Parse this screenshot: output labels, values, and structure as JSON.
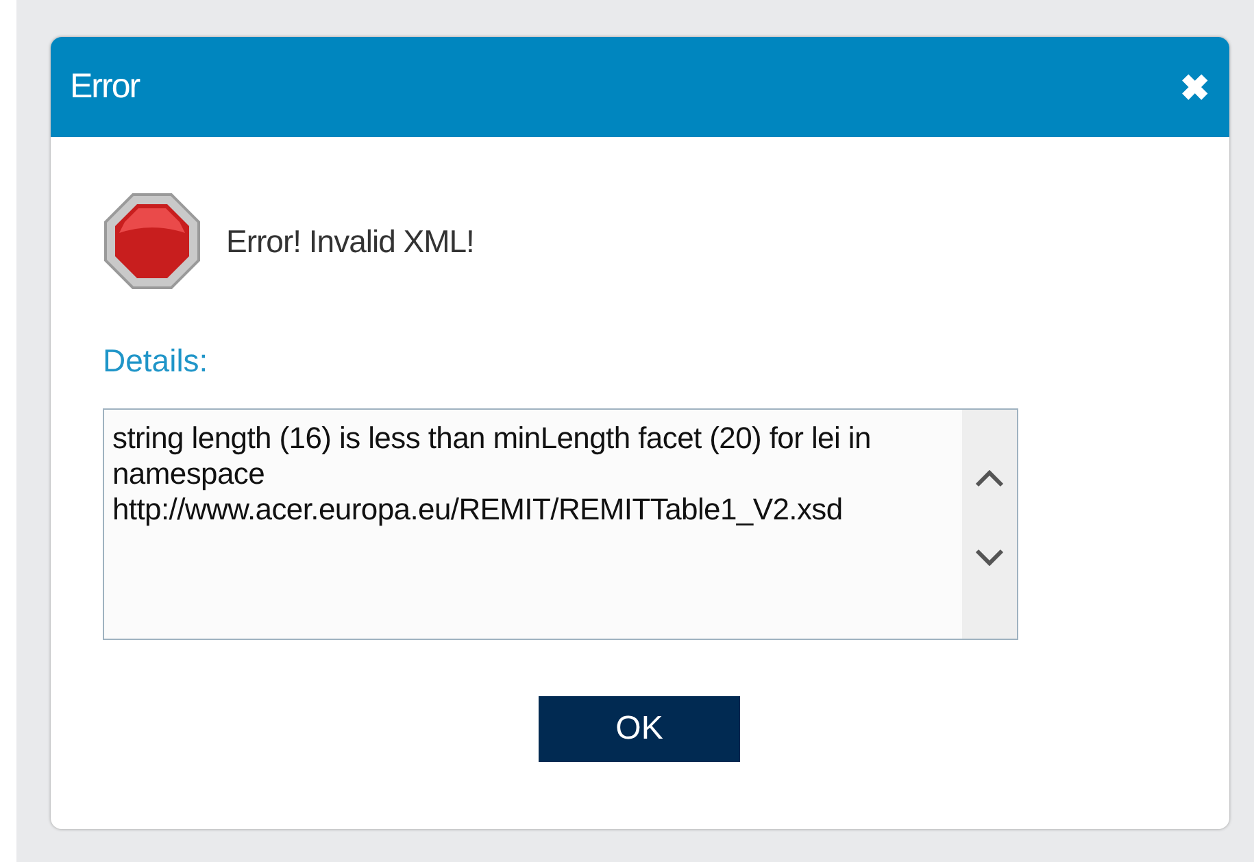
{
  "window": {
    "title": "Error",
    "close": "✖"
  },
  "message": "Error! Invalid XML!",
  "details": {
    "label": "Details:",
    "text": "string length (16) is less than minLength facet (20) for lei in namespace http://www.acer.europa.eu/REMIT/REMITTable1_V2.xsd"
  },
  "buttons": [
    "OK"
  ]
}
